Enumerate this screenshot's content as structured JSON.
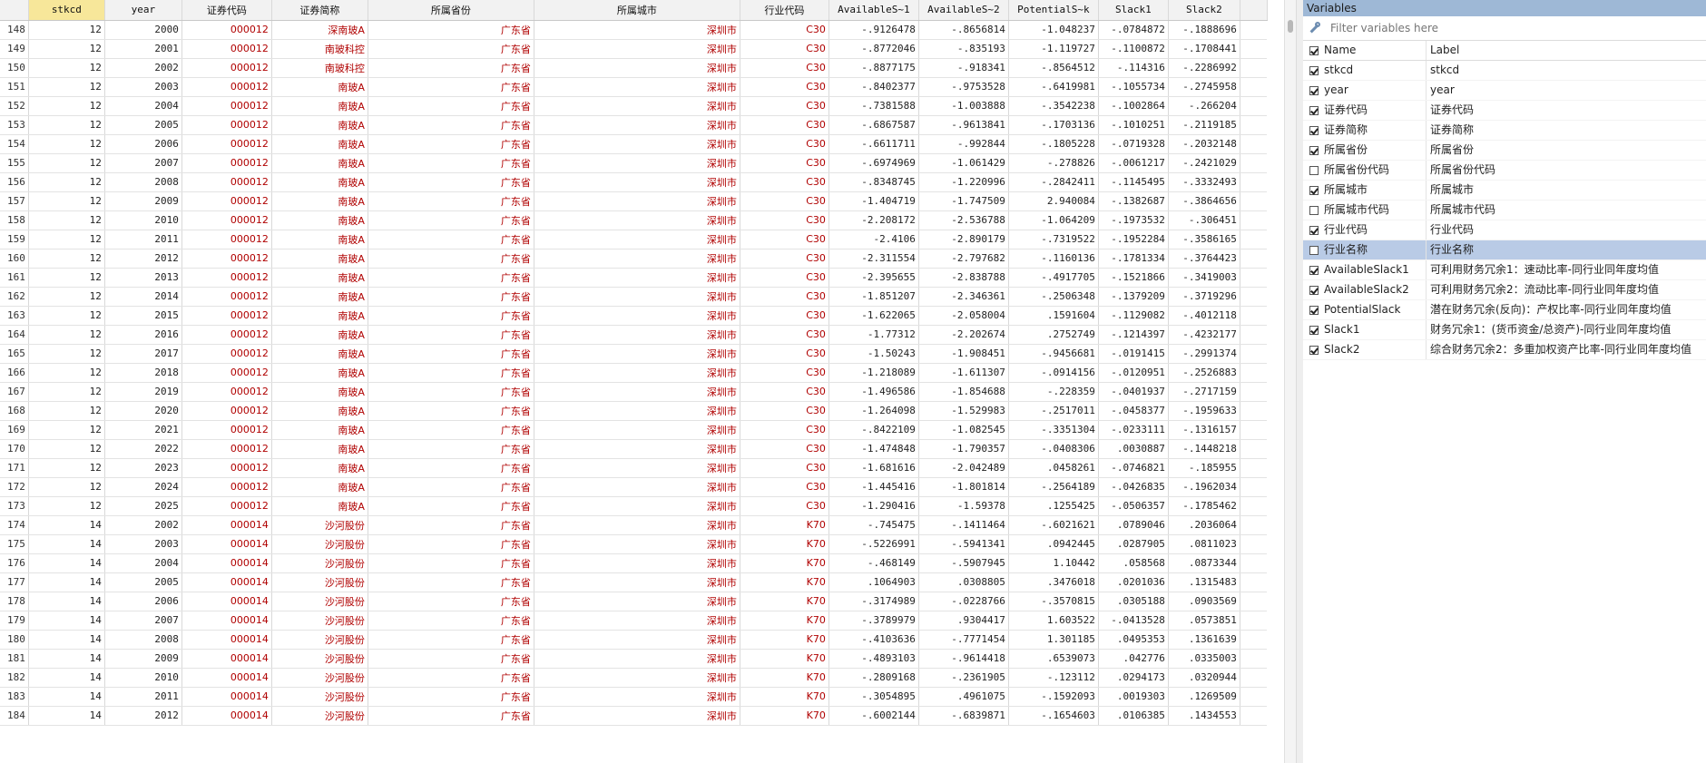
{
  "grid": {
    "columns": [
      {
        "label": "stkcd",
        "width": 84,
        "kind": "num",
        "active": true
      },
      {
        "label": "year",
        "width": 85,
        "kind": "num"
      },
      {
        "label": "证券代码",
        "width": 99,
        "kind": "str"
      },
      {
        "label": "证券简称",
        "width": 106,
        "kind": "str"
      },
      {
        "label": "所属省份",
        "width": 183,
        "kind": "str"
      },
      {
        "label": "所属城市",
        "width": 227,
        "kind": "str"
      },
      {
        "label": "行业代码",
        "width": 98,
        "kind": "str"
      },
      {
        "label": "AvailableS~1",
        "width": 99,
        "kind": "num"
      },
      {
        "label": "AvailableS~2",
        "width": 99,
        "kind": "num"
      },
      {
        "label": "PotentialS~k",
        "width": 99,
        "kind": "num"
      },
      {
        "label": "Slack1",
        "width": 77,
        "kind": "num"
      },
      {
        "label": "Slack2",
        "width": 79,
        "kind": "num"
      }
    ],
    "rows": [
      [
        "148",
        "12",
        "2000",
        "000012",
        "深南玻A",
        "广东省",
        "深圳市",
        "C30",
        "-.9126478",
        "-.8656814",
        "-1.048237",
        "-.0784872",
        "-.1888696"
      ],
      [
        "149",
        "12",
        "2001",
        "000012",
        "南玻科控",
        "广东省",
        "深圳市",
        "C30",
        "-.8772046",
        "-.835193",
        "-1.119727",
        "-.1100872",
        "-.1708441"
      ],
      [
        "150",
        "12",
        "2002",
        "000012",
        "南玻科控",
        "广东省",
        "深圳市",
        "C30",
        "-.8877175",
        "-.918341",
        "-.8564512",
        "-.114316",
        "-.2286992"
      ],
      [
        "151",
        "12",
        "2003",
        "000012",
        "南玻A",
        "广东省",
        "深圳市",
        "C30",
        "-.8402377",
        "-.9753528",
        "-.6419981",
        "-.1055734",
        "-.2745958"
      ],
      [
        "152",
        "12",
        "2004",
        "000012",
        "南玻A",
        "广东省",
        "深圳市",
        "C30",
        "-.7381588",
        "-1.003888",
        "-.3542238",
        "-.1002864",
        "-.266204"
      ],
      [
        "153",
        "12",
        "2005",
        "000012",
        "南玻A",
        "广东省",
        "深圳市",
        "C30",
        "-.6867587",
        "-.9613841",
        "-.1703136",
        "-.1010251",
        "-.2119185"
      ],
      [
        "154",
        "12",
        "2006",
        "000012",
        "南玻A",
        "广东省",
        "深圳市",
        "C30",
        "-.6611711",
        "-.992844",
        "-.1805228",
        "-.0719328",
        "-.2032148"
      ],
      [
        "155",
        "12",
        "2007",
        "000012",
        "南玻A",
        "广东省",
        "深圳市",
        "C30",
        "-.6974969",
        "-1.061429",
        "-.278826",
        "-.0061217",
        "-.2421029"
      ],
      [
        "156",
        "12",
        "2008",
        "000012",
        "南玻A",
        "广东省",
        "深圳市",
        "C30",
        "-.8348745",
        "-1.220996",
        "-.2842411",
        "-.1145495",
        "-.3332493"
      ],
      [
        "157",
        "12",
        "2009",
        "000012",
        "南玻A",
        "广东省",
        "深圳市",
        "C30",
        "-1.404719",
        "-1.747509",
        "2.940084",
        "-.1382687",
        "-.3864656"
      ],
      [
        "158",
        "12",
        "2010",
        "000012",
        "南玻A",
        "广东省",
        "深圳市",
        "C30",
        "-2.208172",
        "-2.536788",
        "-1.064209",
        "-.1973532",
        "-.306451"
      ],
      [
        "159",
        "12",
        "2011",
        "000012",
        "南玻A",
        "广东省",
        "深圳市",
        "C30",
        "-2.4106",
        "-2.890179",
        "-.7319522",
        "-.1952284",
        "-.3586165"
      ],
      [
        "160",
        "12",
        "2012",
        "000012",
        "南玻A",
        "广东省",
        "深圳市",
        "C30",
        "-2.311554",
        "-2.797682",
        "-.1160136",
        "-.1781334",
        "-.3764423"
      ],
      [
        "161",
        "12",
        "2013",
        "000012",
        "南玻A",
        "广东省",
        "深圳市",
        "C30",
        "-2.395655",
        "-2.838788",
        "-.4917705",
        "-.1521866",
        "-.3419003"
      ],
      [
        "162",
        "12",
        "2014",
        "000012",
        "南玻A",
        "广东省",
        "深圳市",
        "C30",
        "-1.851207",
        "-2.346361",
        "-.2506348",
        "-.1379209",
        "-.3719296"
      ],
      [
        "163",
        "12",
        "2015",
        "000012",
        "南玻A",
        "广东省",
        "深圳市",
        "C30",
        "-1.622065",
        "-2.058004",
        ".1591604",
        "-.1129082",
        "-.4012118"
      ],
      [
        "164",
        "12",
        "2016",
        "000012",
        "南玻A",
        "广东省",
        "深圳市",
        "C30",
        "-1.77312",
        "-2.202674",
        ".2752749",
        "-.1214397",
        "-.4232177"
      ],
      [
        "165",
        "12",
        "2017",
        "000012",
        "南玻A",
        "广东省",
        "深圳市",
        "C30",
        "-1.50243",
        "-1.908451",
        "-.9456681",
        "-.0191415",
        "-.2991374"
      ],
      [
        "166",
        "12",
        "2018",
        "000012",
        "南玻A",
        "广东省",
        "深圳市",
        "C30",
        "-1.218089",
        "-1.611307",
        "-.0914156",
        "-.0120951",
        "-.2526883"
      ],
      [
        "167",
        "12",
        "2019",
        "000012",
        "南玻A",
        "广东省",
        "深圳市",
        "C30",
        "-1.496586",
        "-1.854688",
        "-.228359",
        "-.0401937",
        "-.2717159"
      ],
      [
        "168",
        "12",
        "2020",
        "000012",
        "南玻A",
        "广东省",
        "深圳市",
        "C30",
        "-1.264098",
        "-1.529983",
        "-.2517011",
        "-.0458377",
        "-.1959633"
      ],
      [
        "169",
        "12",
        "2021",
        "000012",
        "南玻A",
        "广东省",
        "深圳市",
        "C30",
        "-.8422109",
        "-1.082545",
        "-.3351304",
        "-.0233111",
        "-.1316157"
      ],
      [
        "170",
        "12",
        "2022",
        "000012",
        "南玻A",
        "广东省",
        "深圳市",
        "C30",
        "-1.474848",
        "-1.790357",
        "-.0408306",
        ".0030887",
        "-.1448218"
      ],
      [
        "171",
        "12",
        "2023",
        "000012",
        "南玻A",
        "广东省",
        "深圳市",
        "C30",
        "-1.681616",
        "-2.042489",
        ".0458261",
        "-.0746821",
        "-.185955"
      ],
      [
        "172",
        "12",
        "2024",
        "000012",
        "南玻A",
        "广东省",
        "深圳市",
        "C30",
        "-1.445416",
        "-1.801814",
        "-.2564189",
        "-.0426835",
        "-.1962034"
      ],
      [
        "173",
        "12",
        "2025",
        "000012",
        "南玻A",
        "广东省",
        "深圳市",
        "C30",
        "-1.290416",
        "-1.59378",
        ".1255425",
        "-.0506357",
        "-.1785462"
      ],
      [
        "174",
        "14",
        "2002",
        "000014",
        "沙河股份",
        "广东省",
        "深圳市",
        "K70",
        "-.745475",
        "-.1411464",
        "-.6021621",
        ".0789046",
        ".2036064"
      ],
      [
        "175",
        "14",
        "2003",
        "000014",
        "沙河股份",
        "广东省",
        "深圳市",
        "K70",
        "-.5226991",
        "-.5941341",
        ".0942445",
        ".0287905",
        ".0811023"
      ],
      [
        "176",
        "14",
        "2004",
        "000014",
        "沙河股份",
        "广东省",
        "深圳市",
        "K70",
        "-.468149",
        "-.5907945",
        "1.10442",
        ".058568",
        ".0873344"
      ],
      [
        "177",
        "14",
        "2005",
        "000014",
        "沙河股份",
        "广东省",
        "深圳市",
        "K70",
        ".1064903",
        ".0308805",
        ".3476018",
        ".0201036",
        ".1315483"
      ],
      [
        "178",
        "14",
        "2006",
        "000014",
        "沙河股份",
        "广东省",
        "深圳市",
        "K70",
        "-.3174989",
        "-.0228766",
        "-.3570815",
        ".0305188",
        ".0903569"
      ],
      [
        "179",
        "14",
        "2007",
        "000014",
        "沙河股份",
        "广东省",
        "深圳市",
        "K70",
        "-.3789979",
        ".9304417",
        "1.603522",
        "-.0413528",
        ".0573851"
      ],
      [
        "180",
        "14",
        "2008",
        "000014",
        "沙河股份",
        "广东省",
        "深圳市",
        "K70",
        "-.4103636",
        "-.7771454",
        "1.301185",
        ".0495353",
        ".1361639"
      ],
      [
        "181",
        "14",
        "2009",
        "000014",
        "沙河股份",
        "广东省",
        "深圳市",
        "K70",
        "-.4893103",
        "-.9614418",
        ".6539073",
        ".042776",
        ".0335003"
      ],
      [
        "182",
        "14",
        "2010",
        "000014",
        "沙河股份",
        "广东省",
        "深圳市",
        "K70",
        "-.2809168",
        "-.2361905",
        "-.123112",
        ".0294173",
        ".0320944"
      ],
      [
        "183",
        "14",
        "2011",
        "000014",
        "沙河股份",
        "广东省",
        "深圳市",
        "K70",
        "-.3054895",
        ".4961075",
        "-.1592093",
        ".0019303",
        ".1269509"
      ],
      [
        "184",
        "14",
        "2012",
        "000014",
        "沙河股份",
        "广东省",
        "深圳市",
        "K70",
        "-.6002144",
        "-.6839871",
        "-.1654603",
        ".0106385",
        ".1434553"
      ]
    ]
  },
  "variables": {
    "title": "Variables",
    "filter_placeholder": "Filter variables here",
    "filter_icon": "wrench-icon",
    "header": {
      "name": "Name",
      "label": "Label",
      "checked": true
    },
    "items": [
      {
        "name": "stkcd",
        "label": "stkcd",
        "checked": true
      },
      {
        "name": "year",
        "label": "year",
        "checked": true
      },
      {
        "name": "证券代码",
        "label": "证券代码",
        "checked": true
      },
      {
        "name": "证券简称",
        "label": "证券简称",
        "checked": true
      },
      {
        "name": "所属省份",
        "label": "所属省份",
        "checked": true
      },
      {
        "name": "所属省份代码",
        "label": "所属省份代码",
        "checked": false
      },
      {
        "name": "所属城市",
        "label": "所属城市",
        "checked": true
      },
      {
        "name": "所属城市代码",
        "label": "所属城市代码",
        "checked": false
      },
      {
        "name": "行业代码",
        "label": "行业代码",
        "checked": true
      },
      {
        "name": "行业名称",
        "label": "行业名称",
        "checked": false,
        "selected": true
      },
      {
        "name": "AvailableSlack1",
        "label": "可利用财务冗余1：速动比率-同行业同年度均值",
        "checked": true
      },
      {
        "name": "AvailableSlack2",
        "label": "可利用财务冗余2：流动比率-同行业同年度均值",
        "checked": true
      },
      {
        "name": "PotentialSlack",
        "label": "潜在财务冗余(反向)：产权比率-同行业同年度均值",
        "checked": true
      },
      {
        "name": "Slack1",
        "label": "财务冗余1：(货币资金/总资产)-同行业同年度均值",
        "checked": true
      },
      {
        "name": "Slack2",
        "label": "综合财务冗余2：多重加权资产比率-同行业同年度均值",
        "checked": true
      }
    ]
  },
  "colors": {
    "string_text": "#b00000",
    "active_header": "#f7e79a",
    "panel_title": "#9eb8d6",
    "selected_row": "#b9cbe6"
  }
}
